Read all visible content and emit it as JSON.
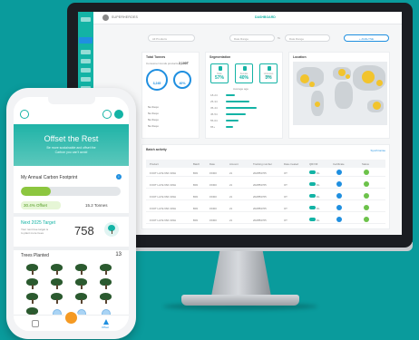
{
  "desktop": {
    "app_name": "SUPERHEROES",
    "page_title": "DASHBOARD",
    "filters": {
      "all_products": "All Products",
      "date_range_start": "Date Range",
      "to_label": "To",
      "date_range_end": "Date Range",
      "action_button": "+ ANALYSE"
    },
    "tonnes_card": {
      "title": "Total Tonnes",
      "subtitle": "Consumer trends products",
      "value": "2,100T",
      "ring1": "3,245",
      "ring2": "40%",
      "rows": [
        "No frequ",
        "No frequ",
        "No frequ",
        "No frequ"
      ]
    },
    "segmentation_card": {
      "title": "Segmentation",
      "boxes": [
        {
          "label": "Male",
          "pct": "57%"
        },
        {
          "label": "Female",
          "pct": "40%"
        },
        {
          "label": "Unknown gender",
          "pct": "3%"
        }
      ],
      "age_title": "Average age",
      "age_rows": [
        "18-24",
        "25-34",
        "35-44",
        "45-54",
        "55-64",
        "65+"
      ],
      "age_values": [
        0.25,
        0.65,
        0.85,
        0.55,
        0.35,
        0.2
      ]
    },
    "location_card": {
      "title": "Location"
    },
    "activity": {
      "title": "Batch activity",
      "link": "Synchronise",
      "columns": [
        "Product",
        "Batch",
        "Date",
        "Amount",
        "Tracking number",
        "Date created",
        "QR/VIZ",
        "Certificate",
        "Status"
      ],
      "rows": [
        [
          "FOOT LAYE 6SK 333H",
          "B03",
          "15300",
          "21",
          "202PB3765",
          "OT",
          "DL"
        ],
        [
          "FOOT LAYE 6SK 333H",
          "B03",
          "15300",
          "21",
          "202PB3765",
          "OT",
          "DL"
        ],
        [
          "FOOT LAYE 6SK 333H",
          "B03",
          "15300",
          "21",
          "202PB3765",
          "OT",
          "DL"
        ],
        [
          "FOOT LAYE 6SK 333H",
          "B03",
          "15300",
          "21",
          "202PB3765",
          "OT",
          "DL"
        ],
        [
          "FOOT LAYE 6SK 333H",
          "B03",
          "15300",
          "21",
          "202PB3765",
          "OT",
          "DL"
        ]
      ],
      "status_colors": [
        "#1f8fe0",
        "#6cc24a"
      ]
    }
  },
  "phone": {
    "hero_title": "Offset the Rest",
    "hero_subtitle_line1": "Be more sustainable and offset the",
    "hero_subtitle_line2": "Carbon you can't avoid",
    "footprint_title": "My Annual Carbon Footprint",
    "footprint_progress": 0.3,
    "offset_chip": "30.4% Offset",
    "tonnes_chip": "15.2 Tonnes",
    "tree_target_title": "Next 2025 Target",
    "tree_target_desc1": "Your next tree target is",
    "tree_target_desc2": "to plant more trees",
    "tree_target_value": "758",
    "trees_planted_title": "Trees Planted",
    "trees_planted_count": "13",
    "tab_label": "Offset"
  },
  "colors": {
    "teal": "#13b3a5",
    "blue": "#1f8fe0",
    "green": "#8cc63f",
    "background": "#0a9b9c"
  }
}
